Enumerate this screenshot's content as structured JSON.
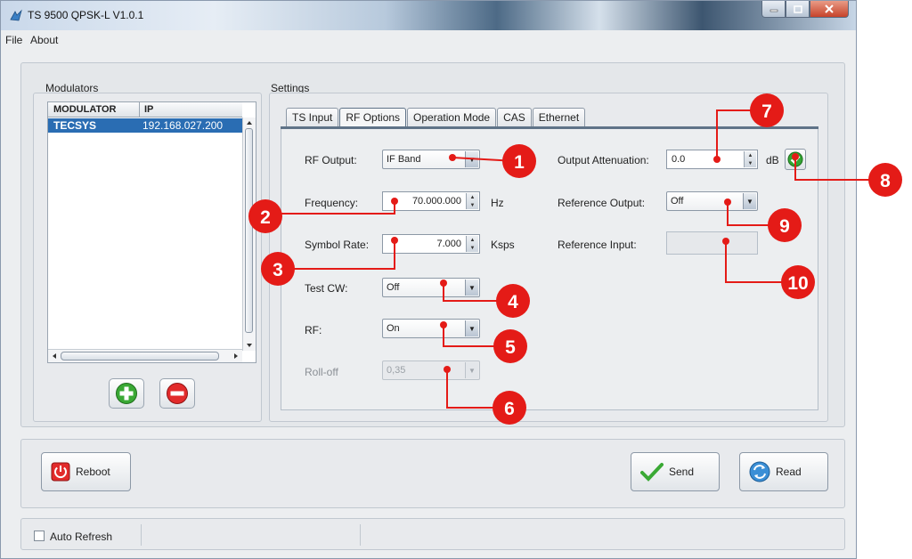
{
  "window": {
    "title": "TS 9500 QPSK-L V1.0.1"
  },
  "menu": {
    "file": "File",
    "about": "About"
  },
  "modulators": {
    "title": "Modulators",
    "columns": [
      "MODULATOR",
      "IP"
    ],
    "rows": [
      {
        "name": "TECSYS",
        "ip": "192.168.027.200"
      }
    ]
  },
  "settings": {
    "title": "Settings",
    "tabs": [
      "TS Input",
      "RF Options",
      "Operation Mode",
      "CAS",
      "Ethernet"
    ],
    "active_tab": "RF Options",
    "rf_output": {
      "label": "RF Output:",
      "value": "IF Band"
    },
    "frequency": {
      "label": "Frequency:",
      "value": "70.000.000",
      "unit": "Hz"
    },
    "symbol_rate": {
      "label": "Symbol Rate:",
      "value": "7.000",
      "unit": "Ksps"
    },
    "test_cw": {
      "label": "Test CW:",
      "value": "Off"
    },
    "rf": {
      "label": "RF:",
      "value": "On"
    },
    "roll_off": {
      "label": "Roll-off",
      "value": "0,35"
    },
    "output_attenuation": {
      "label": "Output Attenuation:",
      "value": "0.0",
      "unit": "dB"
    },
    "reference_output": {
      "label": "Reference Output:",
      "value": "Off"
    },
    "reference_input": {
      "label": "Reference Input:",
      "value": ""
    }
  },
  "buttons": {
    "reboot": "Reboot",
    "send": "Send",
    "read": "Read"
  },
  "status": {
    "auto_refresh": "Auto Refresh"
  },
  "callouts": [
    "1",
    "2",
    "3",
    "4",
    "5",
    "6",
    "7",
    "8",
    "9",
    "10"
  ],
  "colors": {
    "callout": "#e41b17",
    "selection": "#2a6db3",
    "tab_border": "#5f7388"
  }
}
